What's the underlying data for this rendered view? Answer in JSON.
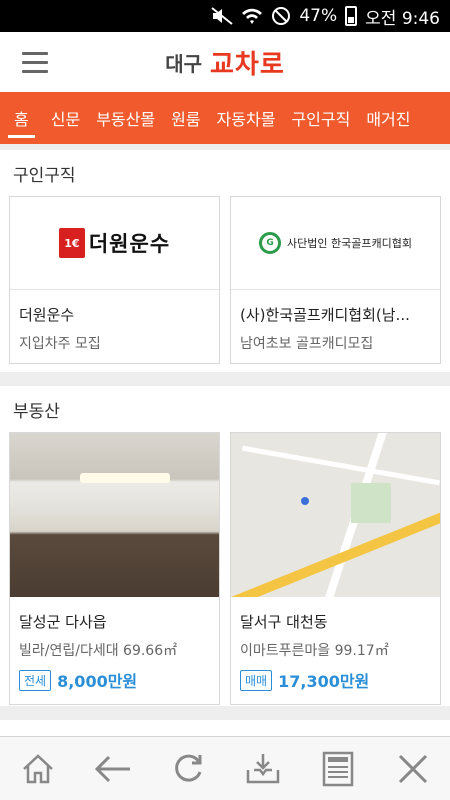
{
  "status_bar": {
    "battery": "47%",
    "time": "오전 9:46"
  },
  "header": {
    "city": "대구",
    "brand": "교차로"
  },
  "nav": {
    "tabs": [
      "홈",
      "신문",
      "부동산몰",
      "원룸",
      "자동차몰",
      "구인구직",
      "매거진"
    ],
    "active_index": 0
  },
  "jobs": {
    "title": "구인구직",
    "cards": [
      {
        "logo_text": "더원운수",
        "title": "더원운수",
        "sub": "지입차주 모집"
      },
      {
        "logo_text": "사단법인 한국골프캐디협회",
        "title": "(사)한국골프캐디협회(남...",
        "sub": "남여초보 골프캐디모집"
      }
    ]
  },
  "realestate": {
    "title": "부동산",
    "cards": [
      {
        "title": "달성군 다사읍",
        "sub": "빌라/연립/다세대 69.66㎡",
        "badge": "전세",
        "price": "8,000만원"
      },
      {
        "title": "달서구 대천동",
        "sub": "이마트푸른마을 99.17㎡",
        "badge": "매매",
        "price": "17,300만원"
      }
    ]
  },
  "bottom_bar": {
    "icons": [
      "home-icon",
      "back-arrow-icon",
      "refresh-icon",
      "download-tray-icon",
      "news-icon",
      "close-icon"
    ]
  },
  "colors": {
    "accent": "#f05a2c",
    "brand": "#e8381f",
    "price": "#2b8fd8"
  }
}
